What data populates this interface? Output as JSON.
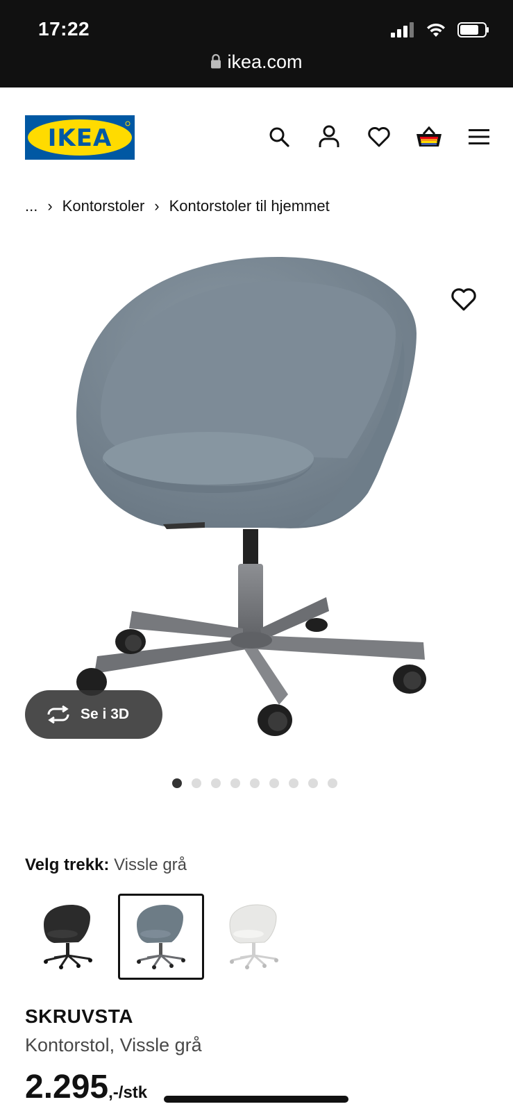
{
  "status_bar": {
    "time": "17:22",
    "url": "ikea.com"
  },
  "header": {
    "brand": "IKEA",
    "brand_colors": {
      "blue": "#0058a3",
      "yellow": "#ffdb00"
    },
    "icons": [
      "search-icon",
      "user-icon",
      "heart-icon",
      "basket-icon",
      "menu-icon"
    ]
  },
  "breadcrumb": {
    "ellipsis": "...",
    "items": [
      "Kontorstoler",
      "Kontorstoler til hjemmet"
    ]
  },
  "gallery": {
    "see_3d_label": "Se i 3D",
    "image_count": 9,
    "active_index": 0
  },
  "variant": {
    "label": "Velg trekk:",
    "selected": "Vissle grå",
    "options": [
      {
        "color": "#2b2b2b",
        "icon": "chair-black"
      },
      {
        "color": "#6d7c86",
        "icon": "chair-grey"
      },
      {
        "color": "#e8e8e6",
        "icon": "chair-white"
      }
    ],
    "selected_index": 1
  },
  "product": {
    "name": "SKRUVSTA",
    "description": "Kontorstol, Vissle grå",
    "price_int": "2.295",
    "price_suffix": ",-/stk"
  }
}
